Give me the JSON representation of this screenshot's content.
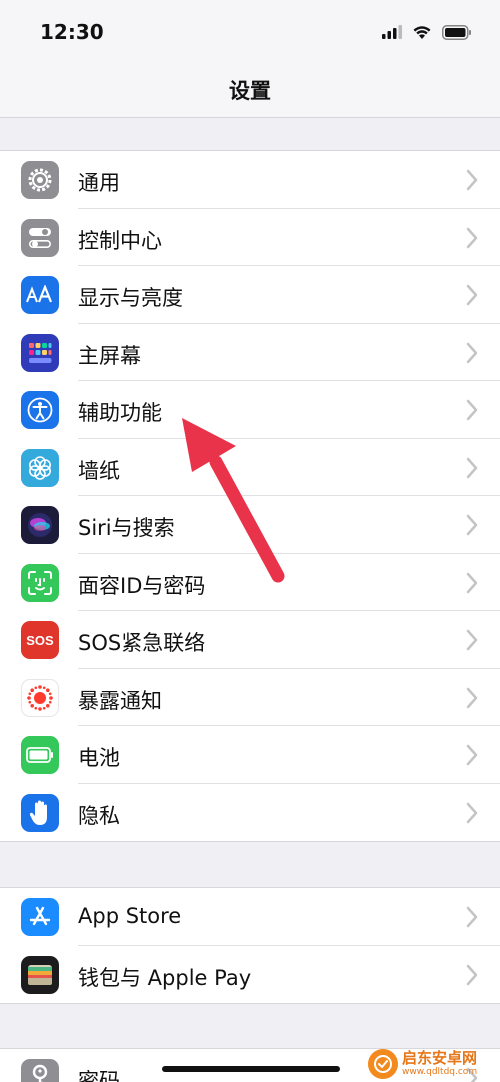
{
  "status_bar": {
    "time": "12:30",
    "icons": [
      "signal-icon",
      "wifi-icon",
      "battery-icon"
    ]
  },
  "nav": {
    "title": "设置"
  },
  "groups": [
    {
      "items": [
        {
          "label": "通用",
          "icon": "gear-icon",
          "color": "#8e8e93"
        },
        {
          "label": "控制中心",
          "icon": "toggles-icon",
          "color": "#8e8e93"
        },
        {
          "label": "显示与亮度",
          "icon": "text-size-icon",
          "color": "#1a73e8"
        },
        {
          "label": "主屏幕",
          "icon": "home-screen-grid-icon",
          "color": "#2f3bb8"
        },
        {
          "label": "辅助功能",
          "icon": "accessibility-icon",
          "color": "#1a73e8"
        },
        {
          "label": "墙纸",
          "icon": "flower-icon",
          "color": "#34aadc"
        },
        {
          "label": "Siri与搜索",
          "icon": "siri-icon",
          "color": "#1c1c3a"
        },
        {
          "label": "面容ID与密码",
          "icon": "face-id-icon",
          "color": "#34c759"
        },
        {
          "label": "SOS紧急联络",
          "icon": "sos-icon",
          "color": "#e0352b"
        },
        {
          "label": "暴露通知",
          "icon": "exposure-icon",
          "color": "#ffffff"
        },
        {
          "label": "电池",
          "icon": "battery-icon",
          "color": "#34c759"
        },
        {
          "label": "隐私",
          "icon": "hand-icon",
          "color": "#1a73e8"
        }
      ]
    },
    {
      "items": [
        {
          "label": "App Store",
          "icon": "app-store-icon",
          "color": "#1a8cff"
        },
        {
          "label": "钱包与 Apple Pay",
          "icon": "wallet-icon",
          "color": "#1c1c1e"
        }
      ]
    },
    {
      "items": [
        {
          "label": "密码",
          "icon": "key-icon",
          "color": "#8e8e93"
        }
      ]
    }
  ],
  "watermark": {
    "name": "启东安卓网",
    "url": "www.qdltdq.com"
  },
  "colors": {
    "annotation_arrow": "#e8334a",
    "chevron": "#c4c4c7"
  }
}
